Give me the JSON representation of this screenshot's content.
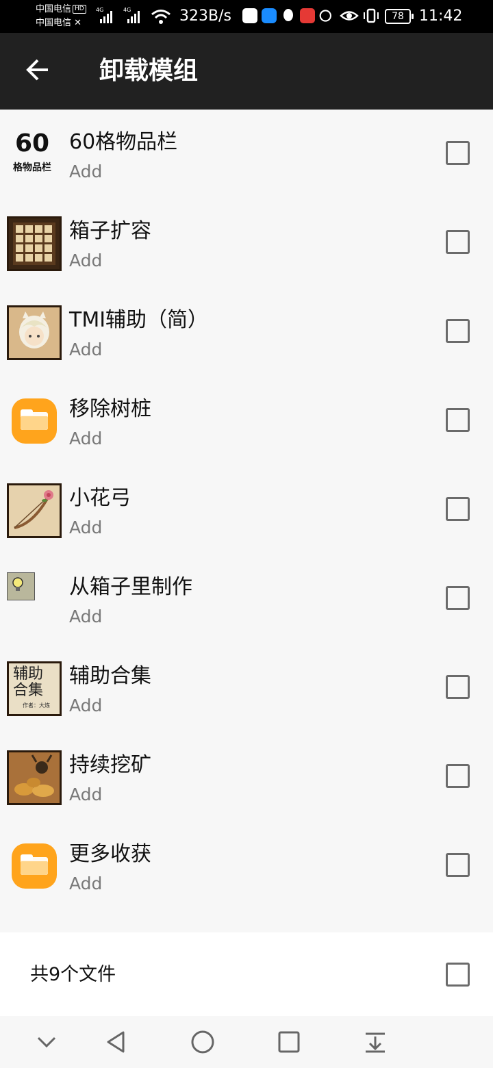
{
  "status_bar": {
    "carrier_1": "中国电信",
    "carrier_1_badge": "HD",
    "carrier_2": "中国电信",
    "sim1_network": "4G",
    "sim2_network": "4G",
    "net_speed": "323B/s",
    "battery": "78",
    "time": "11:42"
  },
  "app_bar": {
    "title": "卸载模组",
    "back_icon": "arrow-left-icon"
  },
  "mods": [
    {
      "name": "60格物品栏",
      "status": "Add",
      "checked": false,
      "icon": "inventory-60-icon",
      "icon_text_big": "60",
      "icon_text_small": "格物品栏"
    },
    {
      "name": "箱子扩容",
      "status": "Add",
      "checked": false,
      "icon": "chest-grid-icon"
    },
    {
      "name": "TMI辅助（简）",
      "status": "Add",
      "checked": false,
      "icon": "character-portrait-icon"
    },
    {
      "name": "移除树桩",
      "status": "Add",
      "checked": false,
      "icon": "folder-icon"
    },
    {
      "name": "小花弓",
      "status": "Add",
      "checked": false,
      "icon": "flower-bow-icon"
    },
    {
      "name": "从箱子里制作",
      "status": "Add",
      "checked": false,
      "icon": "lightbulb-icon"
    },
    {
      "name": "辅助合集",
      "status": "Add",
      "checked": false,
      "icon": "helper-collection-icon",
      "icon_text_1": "辅助",
      "icon_text_2": "合集",
      "icon_text_3": "作者：大炼"
    },
    {
      "name": "持续挖矿",
      "status": "Add",
      "checked": false,
      "icon": "mining-icon"
    },
    {
      "name": "更多收获",
      "status": "Add",
      "checked": false,
      "icon": "folder-icon"
    }
  ],
  "footer": {
    "summary": "共9个文件",
    "select_all_checked": false
  },
  "nav_bar": {
    "icons": [
      "chevron-down-icon",
      "back-triangle-icon",
      "home-circle-icon",
      "recents-square-icon",
      "pull-down-icon"
    ]
  },
  "colors": {
    "app_bar": "#212121",
    "status_bar": "#000000",
    "list_bg": "#f7f7f7",
    "folder_orange": "#ffa41c",
    "subtext": "#7a7a7a"
  }
}
